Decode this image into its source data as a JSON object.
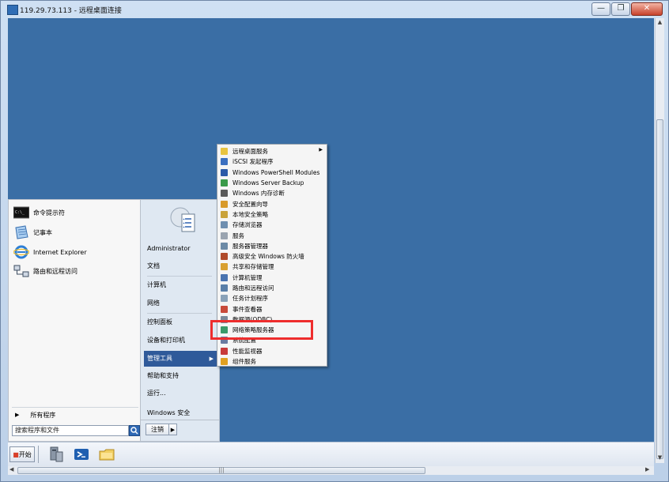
{
  "window": {
    "title": "119.29.73.113 - 远程桌面连接",
    "buttons": {
      "minimize": "—",
      "restore": "❐",
      "close": "✕"
    }
  },
  "start_menu": {
    "pinned": [
      {
        "label": "命令提示符",
        "icon": "cmd-icon",
        "color": "#1a1a1a"
      },
      {
        "label": "记事本",
        "icon": "notepad-icon",
        "color": "#4a86c8"
      },
      {
        "label": "Internet Explorer",
        "icon": "ie-icon",
        "color": "#2d7fd6"
      },
      {
        "label": "路由和远程访问",
        "icon": "routing-icon",
        "color": "#5a7fa8"
      }
    ],
    "all_programs": "所有程序",
    "search_placeholder": "搜索程序和文件",
    "right": {
      "user": "Administrator",
      "documents": "文档",
      "computer": "计算机",
      "network": "网络",
      "control_panel": "控制面板",
      "devices_printers": "设备和打印机",
      "admin_tools": "管理工具",
      "help": "帮助和支持",
      "run": "运行...",
      "security": "Windows 安全"
    },
    "logoff": "注销"
  },
  "admin_tools_menu": [
    {
      "label": "远程桌面服务",
      "color": "#e8c440",
      "has_submenu": true
    },
    {
      "label": "iSCSI 发起程序",
      "color": "#3a6fc0"
    },
    {
      "label": "Windows PowerShell Modules",
      "color": "#2b5aa8"
    },
    {
      "label": "Windows Server Backup",
      "color": "#3a9a4a"
    },
    {
      "label": "Windows 内存诊断",
      "color": "#5a5a5a"
    },
    {
      "label": "安全配置向导",
      "color": "#d89a2a"
    },
    {
      "label": "本地安全策略",
      "color": "#c9a33a"
    },
    {
      "label": "存储浏览器",
      "color": "#6f8fb0"
    },
    {
      "label": "服务",
      "color": "#9aa4b0"
    },
    {
      "label": "服务器管理器",
      "color": "#6c8aa6"
    },
    {
      "label": "高级安全 Windows 防火墙",
      "color": "#b04a2a"
    },
    {
      "label": "共享和存储管理",
      "color": "#d9a030"
    },
    {
      "label": "计算机管理",
      "color": "#4a74b0"
    },
    {
      "label": "路由和远程访问",
      "color": "#5a7fa8"
    },
    {
      "label": "任务计划程序",
      "color": "#8aa2b8"
    },
    {
      "label": "事件查看器",
      "color": "#c84a3a"
    },
    {
      "label": "数据源(ODBC)",
      "color": "#7a8a9a"
    },
    {
      "label": "网络策略服务器",
      "color": "#3a9a6a"
    },
    {
      "label": "系统配置",
      "color": "#6a7aa0"
    },
    {
      "label": "性能监视器",
      "color": "#c83a3a"
    },
    {
      "label": "组件服务",
      "color": "#e0a020"
    }
  ],
  "taskbar": {
    "start": "开始"
  },
  "colors": {
    "desktop": "#3a6ea5",
    "highlight_box": "#ee2d2d",
    "menu_active": "#2f5a9a"
  }
}
